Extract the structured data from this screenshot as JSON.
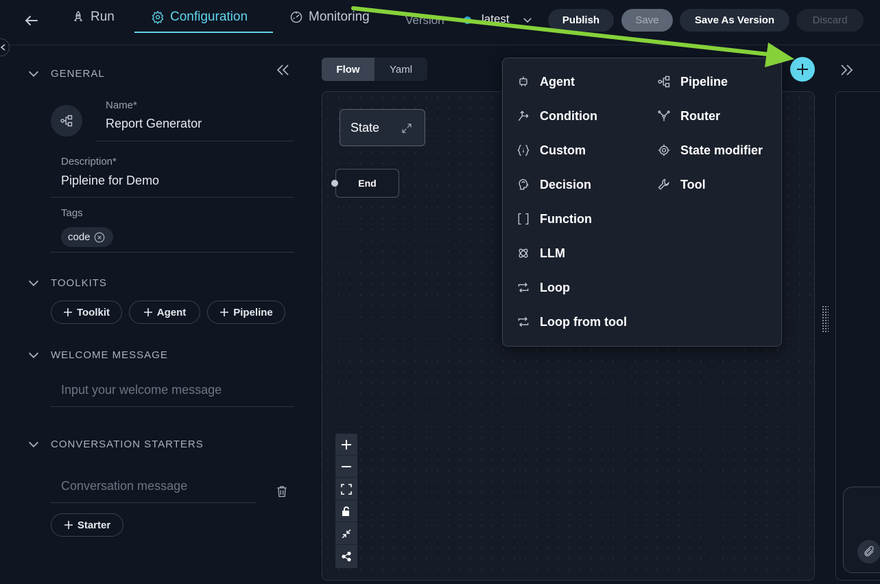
{
  "header": {
    "tabs": [
      {
        "label": "Run",
        "icon": "rocket-icon"
      },
      {
        "label": "Configuration",
        "icon": "gear-icon"
      },
      {
        "label": "Monitoring",
        "icon": "monitoring-icon"
      }
    ],
    "version_label": "Version",
    "version_value": "latest",
    "publish_label": "Publish",
    "save_label": "Save",
    "save_as_label": "Save As Version",
    "discard_label": "Discard",
    "accent_color": "#5fd6ee"
  },
  "left_panel": {
    "general": {
      "title": "GENERAL",
      "name_label": "Name*",
      "name_value": "Report Generator",
      "description_label": "Description*",
      "description_value": "Pipleine for Demo",
      "tags_label": "Tags",
      "tags": [
        "code"
      ]
    },
    "toolkits": {
      "title": "TOOLKITS",
      "buttons": [
        "Toolkit",
        "Agent",
        "Pipeline"
      ]
    },
    "welcome": {
      "title": "WELCOME MESSAGE",
      "placeholder": "Input your welcome message"
    },
    "starters": {
      "title": "CONVERSATION STARTERS",
      "placeholder": "Conversation message",
      "add_label": "Starter"
    }
  },
  "canvas": {
    "view_tabs": [
      "Flow",
      "Yaml"
    ],
    "nodes": {
      "state": "State",
      "end": "End"
    }
  },
  "add_menu": {
    "left_items": [
      "Agent",
      "Condition",
      "Custom",
      "Decision",
      "Function",
      "LLM",
      "Loop",
      "Loop from tool"
    ],
    "right_items": [
      "Pipeline",
      "Router",
      "State modifier",
      "Tool"
    ]
  },
  "annotation": {
    "arrow_color": "#86d13a"
  }
}
